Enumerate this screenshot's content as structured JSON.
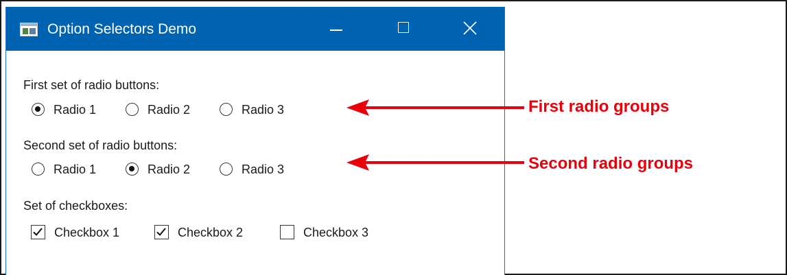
{
  "window": {
    "title": "Option Selectors Demo",
    "accent_color": "#0063b1",
    "controls": {
      "minimize_icon": "minimize-icon",
      "maximize_icon": "maximize-icon",
      "close_icon": "close-icon"
    }
  },
  "groups": {
    "radio1": {
      "label": "First set of radio buttons:",
      "options": [
        {
          "label": "Radio 1",
          "selected": true
        },
        {
          "label": "Radio 2",
          "selected": false
        },
        {
          "label": "Radio 3",
          "selected": false
        }
      ]
    },
    "radio2": {
      "label": "Second set of radio buttons:",
      "options": [
        {
          "label": "Radio 1",
          "selected": false
        },
        {
          "label": "Radio 2",
          "selected": true
        },
        {
          "label": "Radio 3",
          "selected": false
        }
      ]
    },
    "checks": {
      "label": "Set of checkboxes:",
      "options": [
        {
          "label": "Checkbox 1",
          "checked": true
        },
        {
          "label": "Checkbox 2",
          "checked": true
        },
        {
          "label": "Checkbox 3",
          "checked": false
        }
      ]
    }
  },
  "annotations": {
    "first": "First radio groups",
    "second": "Second radio groups",
    "color": "#e8000b"
  }
}
